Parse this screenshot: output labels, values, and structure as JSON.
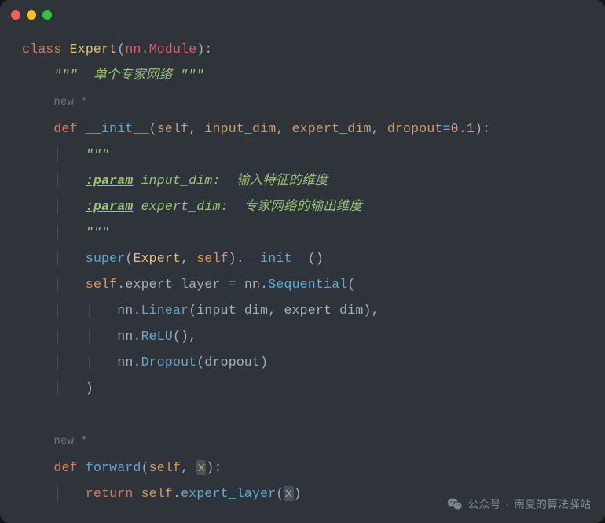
{
  "titlebar": {
    "buttons": [
      "close",
      "minimize",
      "zoom"
    ]
  },
  "code": {
    "kw_class": "class",
    "cls_Expert": "Expert",
    "nn": "nn",
    "Module": "Module",
    "doc1": "\"\"\"",
    "doc1_txt": "  单个专家网络 ",
    "doc1_end": "\"\"\"",
    "new": "new *",
    "kw_def": "def",
    "fn_init": "__init__",
    "self": "self",
    "p_input_dim": "input_dim",
    "p_expert_dim": "expert_dim",
    "p_dropout": "dropout",
    "eq": "=",
    "num_01": "0.1",
    "doc2a": "\"\"\"",
    "tag_param": ":param",
    "doc_input": " input_dim: ",
    "doc_input_zh": " 输入特征的维度",
    "doc_expert": " expert_dim: ",
    "doc_expert_zh": " 专家网络的输出维度",
    "doc2b": "\"\"\"",
    "super": "super",
    "dot": ".",
    "initcall": "__init__",
    "expert_layer": "expert_layer",
    "Sequential": "Sequential",
    "Linear": "Linear",
    "ReLU": "ReLU",
    "Dropout": "Dropout",
    "fn_forward": "forward",
    "x": "x",
    "kw_return": "return"
  },
  "watermark": {
    "label1": "公众号",
    "sep": "·",
    "label2": "南夏的算法驿站"
  },
  "colors": {
    "bg": "#2f343a",
    "keyword": "#d7795e",
    "class": "#e6c07b",
    "func": "#5faad4",
    "param": "#d19a66",
    "string": "#98c379",
    "punct": "#a6b0bb",
    "muted": "#6d757f"
  }
}
